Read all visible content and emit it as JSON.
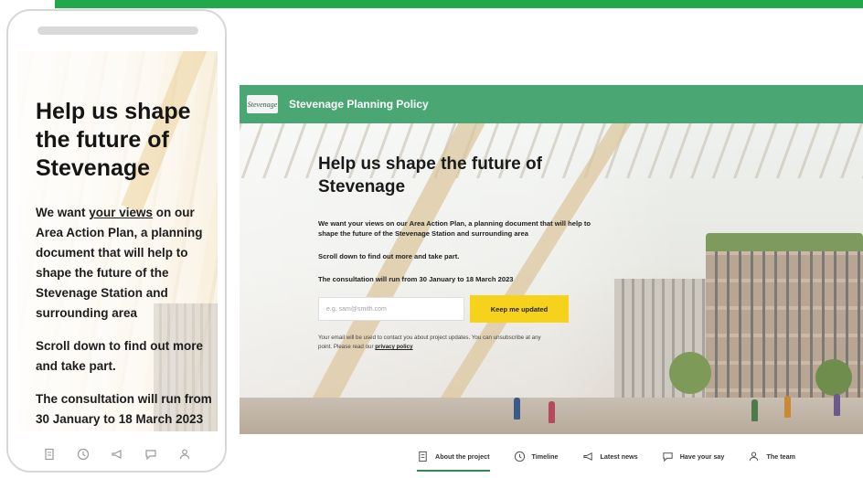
{
  "colors": {
    "brand_green": "#4aa673",
    "stripe_green": "#21a84a",
    "cta_yellow": "#f6d21b"
  },
  "mobile": {
    "title": "Help us shape the future of Stevenage",
    "intro_prefix": "We want ",
    "intro_highlight": "your views",
    "intro_suffix": " on our Area Action Plan, a planning document that will help to shape the future of the Stevenage Station and surrounding area",
    "scroll_text": "Scroll down to find out more and take part.",
    "consultation_text": "The consultation will run from 30 January to 18 March 2023",
    "tab_icons": [
      "document-icon",
      "clock-icon",
      "megaphone-icon",
      "speech-bubble-icon",
      "people-icon"
    ]
  },
  "desktop": {
    "logo_text": "Stevenage",
    "site_title": "Stevenage Planning Policy",
    "title": "Help us shape the future of Stevenage",
    "intro": "We want your views on our Area Action Plan, a planning document that will help to shape the future of the Stevenage Station and surrounding area",
    "scroll_text": "Scroll down to find out more and take part.",
    "consultation_text": "The consultation will run from 30 January to 18 March 2023",
    "email_placeholder": "e.g. sam@smith.com",
    "cta_label": "Keep me updated",
    "disclaimer": "Your email will be used to contact you about project updates. You can unsubscribe at any point. Please read our ",
    "privacy_link": "privacy policy",
    "nav": [
      {
        "label": "About the project",
        "icon": "document-icon",
        "active": true
      },
      {
        "label": "Timeline",
        "icon": "clock-icon",
        "active": false
      },
      {
        "label": "Latest news",
        "icon": "megaphone-icon",
        "active": false
      },
      {
        "label": "Have your say",
        "icon": "speech-bubble-icon",
        "active": false
      },
      {
        "label": "The team",
        "icon": "people-icon",
        "active": false
      }
    ]
  }
}
